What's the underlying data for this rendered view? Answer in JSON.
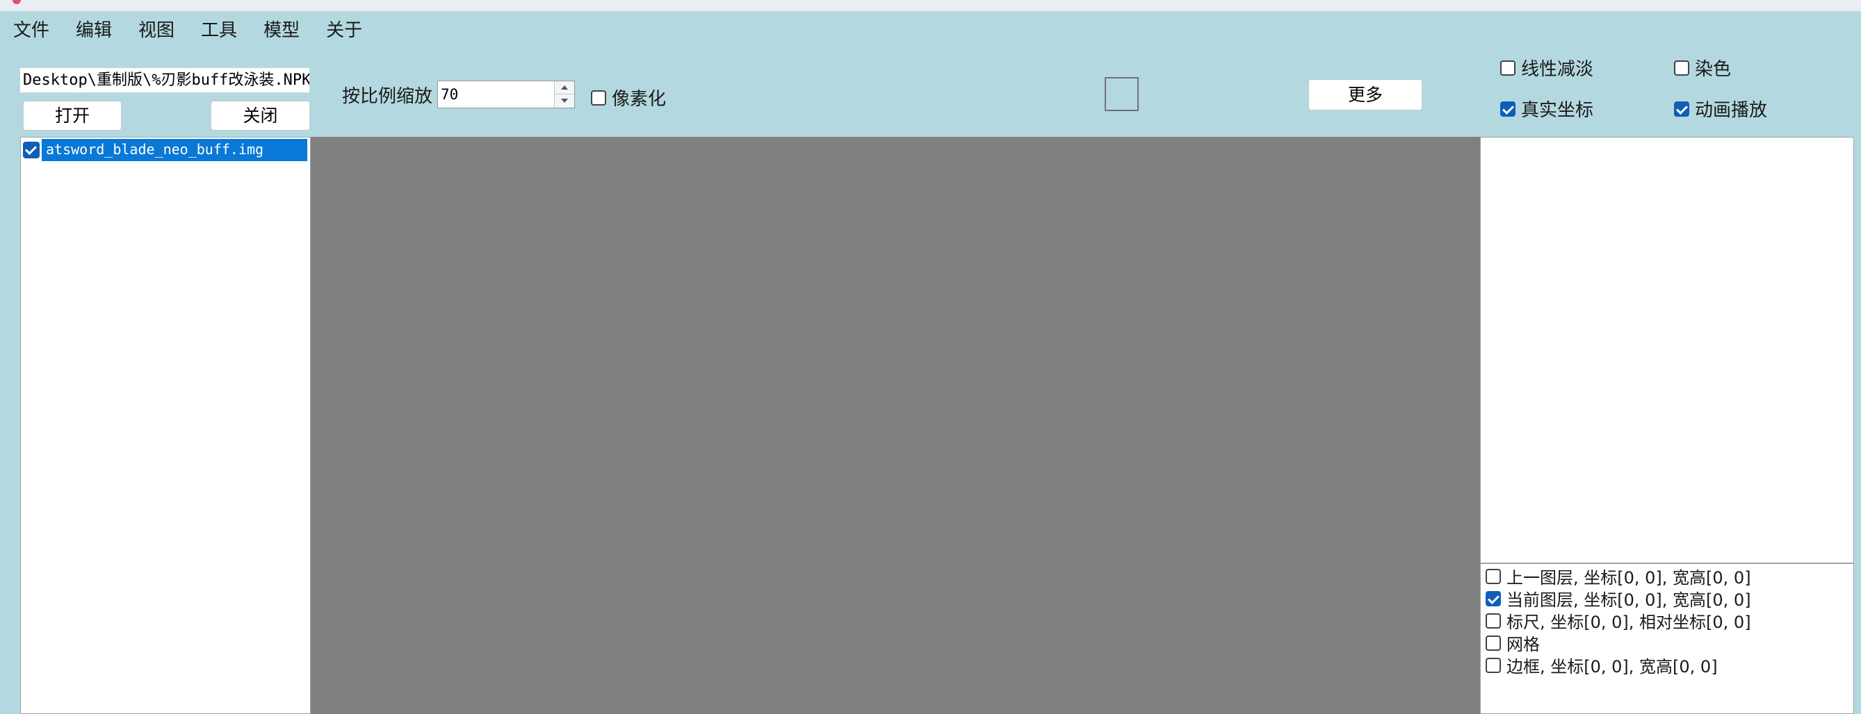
{
  "menu": {
    "items": [
      {
        "id": "file",
        "label": "文件"
      },
      {
        "id": "edit",
        "label": "编辑"
      },
      {
        "id": "view",
        "label": "视图"
      },
      {
        "id": "tools",
        "label": "工具"
      },
      {
        "id": "model",
        "label": "模型"
      },
      {
        "id": "about",
        "label": "关于"
      }
    ]
  },
  "file_panel": {
    "path": "Desktop\\重制版\\%刃影buff改泳装.NPK",
    "open_label": "打开",
    "close_label": "关闭",
    "files": [
      {
        "name": "atsword_blade_neo_buff.img",
        "checked": true,
        "selected": true
      }
    ]
  },
  "toolbar": {
    "scale_label": "按比例缩放",
    "scale_value": "70",
    "pixelate": {
      "label": "像素化",
      "checked": false
    },
    "more_label": "更多",
    "swatch_color": "#b4d8df",
    "linear_fade": {
      "label": "线性减淡",
      "checked": false
    },
    "dye": {
      "label": "染色",
      "checked": false
    },
    "real_coords": {
      "label": "真实坐标",
      "checked": true
    },
    "animation": {
      "label": "动画播放",
      "checked": true
    }
  },
  "layers": {
    "items": [
      {
        "label": "上一图层, 坐标[0, 0], 宽高[0, 0]",
        "checked": false
      },
      {
        "label": "当前图层, 坐标[0, 0], 宽高[0, 0]",
        "checked": true
      },
      {
        "label": "标尺, 坐标[0, 0], 相对坐标[0, 0]",
        "checked": false
      },
      {
        "label": "网格",
        "checked": false
      },
      {
        "label": "边框, 坐标[0, 0], 宽高[0, 0]",
        "checked": false
      }
    ]
  },
  "colors": {
    "background": "#b4d8df",
    "canvas": "#808080",
    "selection": "#0a78d6",
    "checkbox_checked": "#0d5fb8"
  }
}
